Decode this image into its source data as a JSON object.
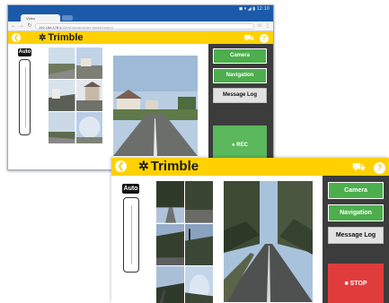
{
  "browser": {
    "os_status": "◼ ▾ ◢ ▮ 12:10",
    "tab_title": "Video",
    "url_host": "192.168.178.1",
    "url_path": "/WebDisplay/index.html#/control",
    "nav_back": "←",
    "nav_forward": "→",
    "nav_reload": "↻",
    "star": "☆",
    "menu": "⋮"
  },
  "app": {
    "brand": "Trimble",
    "brand_mark": "✲",
    "back_glyph": "❮",
    "help_glyph": "?",
    "truck_glyph": "⛟",
    "auto_label": "Auto",
    "buttons": {
      "camera": "Camera",
      "navigation": "Navigation",
      "message_log": "Message Log"
    },
    "rec_label": "● REC",
    "stop_label": "■ STOP"
  },
  "colors": {
    "header_yellow": "#ffd100",
    "panel_dark": "#3c3c3c",
    "button_green": "#4cae4c",
    "rec_green": "#5cb85c",
    "stop_red": "#e03c3c"
  }
}
